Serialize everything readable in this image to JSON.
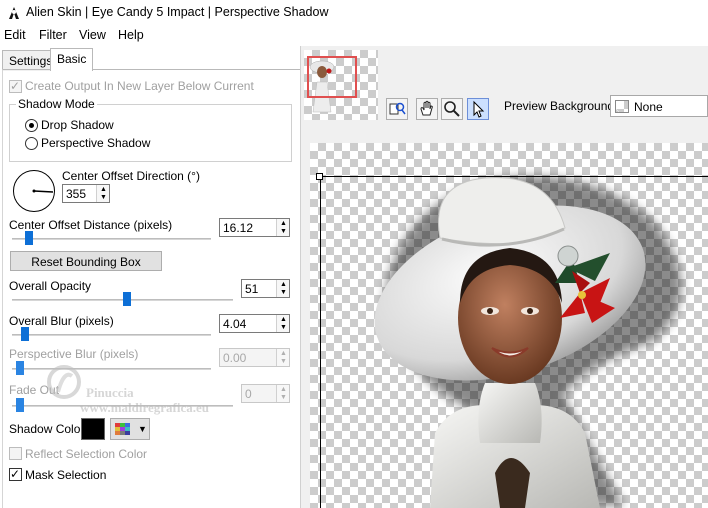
{
  "window": {
    "title": "Alien Skin | Eye Candy 5 Impact | Perspective Shadow"
  },
  "menu": [
    "Edit",
    "Filter",
    "View",
    "Help"
  ],
  "tabs": [
    {
      "label": "Settings",
      "active": false
    },
    {
      "label": "Basic",
      "active": true
    }
  ],
  "options": {
    "create_output_label": "Create Output In New Layer Below Current",
    "create_output_checked": true,
    "create_output_enabled": false
  },
  "shadow_mode": {
    "label": "Shadow Mode",
    "options": [
      {
        "label": "Drop Shadow",
        "selected": true
      },
      {
        "label": "Perspective Shadow",
        "selected": false
      }
    ]
  },
  "center_offset_direction": {
    "label": "Center Offset Direction (°)",
    "value": "355"
  },
  "sliders": {
    "center_offset_distance": {
      "label": "Center Offset Distance (pixels)",
      "value": "16.12",
      "level": 0.08,
      "enabled": true
    },
    "overall_opacity": {
      "label": "Overall Opacity",
      "value": "51",
      "level": 0.51,
      "enabled": true
    },
    "overall_blur": {
      "label": "Overall Blur (pixels)",
      "value": "4.04",
      "level": 0.03,
      "enabled": true
    },
    "perspective_blur": {
      "label": "Perspective Blur (pixels)",
      "value": "0.00",
      "level": 0.0,
      "enabled": false
    },
    "fade_out": {
      "label": "Fade Out",
      "value": "0",
      "level": 0.0,
      "enabled": false
    }
  },
  "reset_button": {
    "label": "Reset Bounding Box"
  },
  "shadow_color": {
    "label": "Shadow Color",
    "color": "#000000"
  },
  "reflect_selection": {
    "label": "Reflect Selection Color",
    "checked": false,
    "enabled": false
  },
  "mask_selection": {
    "label": "Mask Selection",
    "checked": true
  },
  "watermark": {
    "line1": "Pinuccia",
    "line2": "www.maldiregrafica.eu"
  },
  "preview": {
    "background_label": "Preview Background:",
    "background_value": "None",
    "tools": [
      "hand-zoom-icon",
      "hand-icon",
      "magnifier-icon",
      "arrow-pointer-icon"
    ],
    "active_tool": "arrow-pointer-icon"
  },
  "colors": {
    "slider_thumb": "#0d6fd6",
    "nav_rect": "#e05050"
  }
}
